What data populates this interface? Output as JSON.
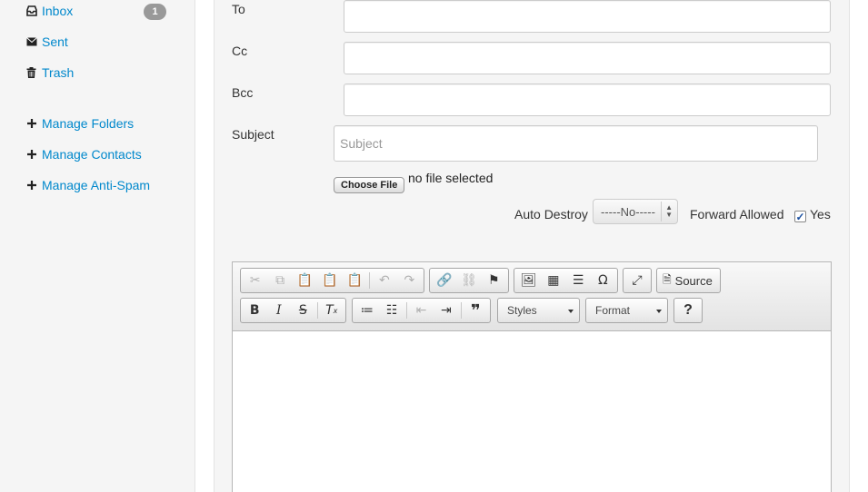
{
  "sidebar": {
    "inbox": {
      "label": "Inbox",
      "count": "1",
      "icon": "inbox-icon"
    },
    "sent": {
      "label": "Sent",
      "icon": "envelope-icon"
    },
    "trash": {
      "label": "Trash",
      "icon": "trash-icon"
    },
    "manage_folders": {
      "label": "Manage Folders",
      "icon": "plus-icon"
    },
    "manage_contacts": {
      "label": "Manage Contacts",
      "icon": "plus-icon"
    },
    "manage_antispam": {
      "label": "Manage Anti-Spam",
      "icon": "plus-icon"
    }
  },
  "form": {
    "to_label": "To",
    "to_value": "",
    "cc_label": "Cc",
    "cc_value": "",
    "bcc_label": "Bcc",
    "bcc_value": "",
    "subject_label": "Subject",
    "subject_placeholder": "Subject",
    "subject_value": "",
    "choose_file_label": "Choose File",
    "file_status": "no file selected",
    "auto_destroy_label": "Auto Destroy",
    "auto_destroy_value": "-----No-----",
    "forward_allowed_label": "Forward Allowed",
    "forward_allowed_checked": true,
    "yes_label": "Yes"
  },
  "editor": {
    "source_label": "Source",
    "styles_label": "Styles",
    "format_label": "Format",
    "help_label": "?",
    "content": ""
  },
  "colors": {
    "link": "#0088cc",
    "badge": "#999999",
    "panel_bg": "#f5f5f5"
  }
}
